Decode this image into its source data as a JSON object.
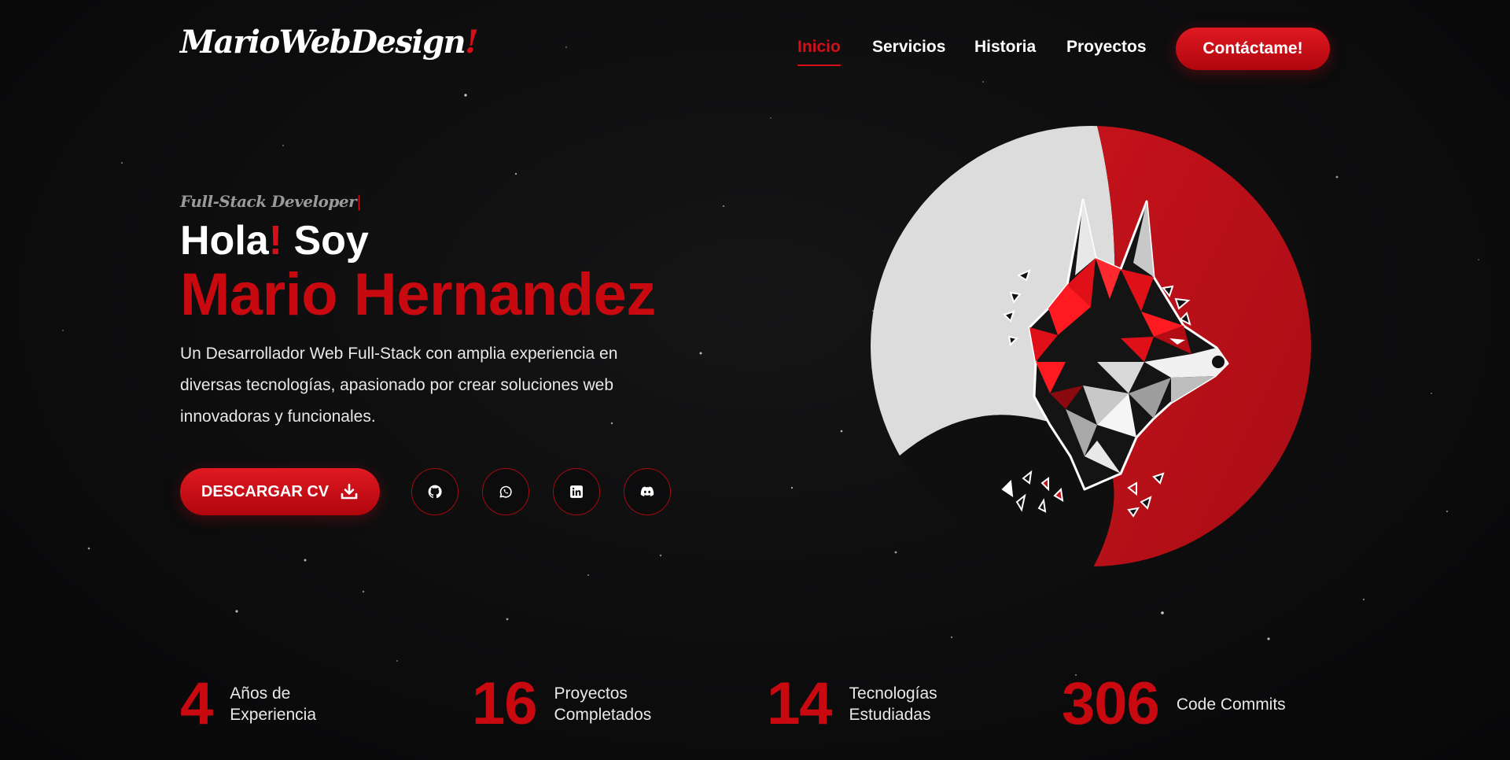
{
  "header": {
    "logo_main": "MarioWebDesign",
    "logo_accent": "!",
    "nav": [
      {
        "label": "Inicio",
        "active": true
      },
      {
        "label": "Servicios",
        "active": false
      },
      {
        "label": "Historia",
        "active": false
      },
      {
        "label": "Proyectos",
        "active": false
      }
    ],
    "cta_label": "Contáctame!"
  },
  "hero": {
    "role": "Full-Stack Developer",
    "role_cursor": "|",
    "greeting_start": "Hola",
    "greeting_bang": "!",
    "greeting_end": " Soy",
    "name": "Mario Hernandez",
    "description": "Un Desarrollador Web Full-Stack con amplia experiencia en diversas tecnologías, apasionado por crear soluciones web innovadoras y funcionales.",
    "cv_button": "DESCARGAR CV",
    "cv_icon": "download-icon",
    "socials": [
      {
        "name": "github",
        "icon": "github-icon"
      },
      {
        "name": "whatsapp",
        "icon": "whatsapp-icon"
      },
      {
        "name": "linkedin",
        "icon": "linkedin-icon"
      },
      {
        "name": "discord",
        "icon": "discord-icon"
      }
    ],
    "image": "geometric-wolf-illustration"
  },
  "stats": [
    {
      "value": "4",
      "label_line1": "Años de",
      "label_line2": "Experiencia"
    },
    {
      "value": "16",
      "label_line1": "Proyectos",
      "label_line2": "Completados"
    },
    {
      "value": "14",
      "label_line1": "Tecnologías",
      "label_line2": "Estudiadas"
    },
    {
      "value": "306",
      "label_line1": "Code Commits",
      "label_line2": ""
    }
  ],
  "colors": {
    "accent": "#d50f17",
    "background": "#0b0b0c",
    "text": "#ffffff"
  }
}
